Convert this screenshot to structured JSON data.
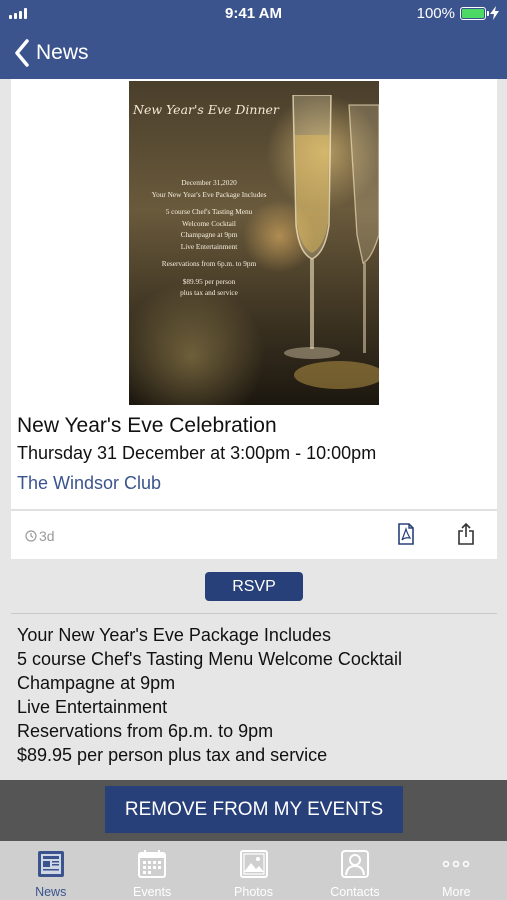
{
  "status_bar": {
    "time": "9:41 AM",
    "battery_percent": "100%"
  },
  "nav": {
    "back_label": "News"
  },
  "flyer": {
    "title": "New Year's Eve Dinner",
    "lines": [
      "December 31,2020",
      "Your New Year's Eve Package Includes",
      "",
      "5 course Chef's Tasting Menu",
      "Welcome Cocktail",
      "Champagne at 9pm",
      "Live Entertainment",
      "",
      "Reservations from 6p.m. to 9pm",
      "",
      "$89.95 per person",
      "plus tax and service"
    ]
  },
  "event": {
    "title": "New Year's Eve Celebration",
    "when": "Thursday 31 December at 3:00pm - 10:00pm",
    "venue": "The Windsor Club",
    "age": "3d"
  },
  "rsvp_label": "RSVP",
  "description": [
    "Your New Year's Eve Package Includes",
    "5 course Chef's Tasting Menu Welcome Cocktail",
    "Champagne at 9pm",
    "Live Entertainment",
    "Reservations from 6p.m. to 9pm",
    "$89.95 per person plus tax and service"
  ],
  "remove_label": "REMOVE FROM MY EVENTS",
  "tabs": [
    {
      "label": "News",
      "icon": "news-icon",
      "active": true
    },
    {
      "label": "Events",
      "icon": "calendar-icon",
      "active": false
    },
    {
      "label": "Photos",
      "icon": "photo-icon",
      "active": false
    },
    {
      "label": "Contacts",
      "icon": "contact-icon",
      "active": false
    },
    {
      "label": "More",
      "icon": "more-icon",
      "active": false
    }
  ],
  "colors": {
    "brand": "#3b548d",
    "button": "#28407a",
    "battery": "#4cd964"
  }
}
